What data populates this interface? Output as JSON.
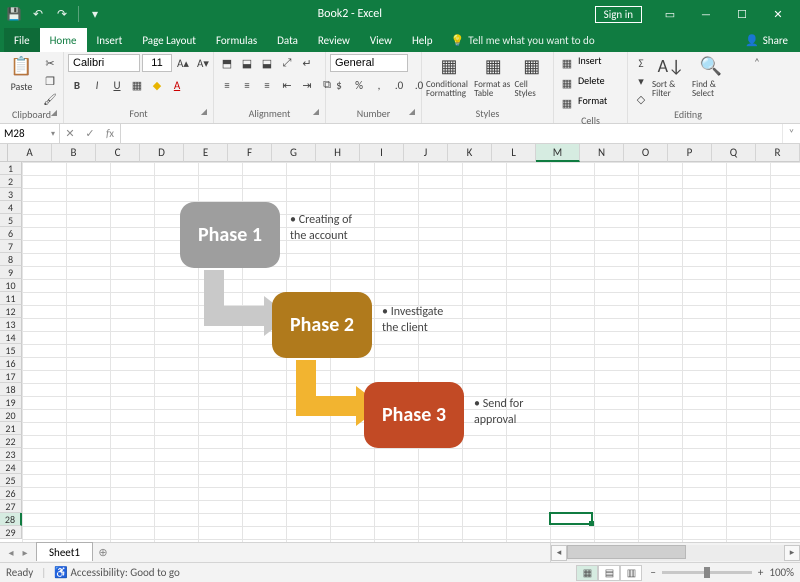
{
  "title": "Book2 - Excel",
  "signin_label": "Sign in",
  "menu": {
    "file": "File",
    "home": "Home",
    "insert": "Insert",
    "page_layout": "Page Layout",
    "formulas": "Formulas",
    "data": "Data",
    "review": "Review",
    "view": "View",
    "help": "Help",
    "tellme": "Tell me what you want to do",
    "share": "Share"
  },
  "ribbon": {
    "clipboard": {
      "paste": "Paste",
      "label": "Clipboard"
    },
    "font": {
      "name": "Calibri",
      "size": "11",
      "label": "Font"
    },
    "alignment": {
      "label": "Alignment"
    },
    "number": {
      "format": "General",
      "label": "Number"
    },
    "styles": {
      "cond": "Conditional Formatting",
      "table": "Format as Table",
      "cell": "Cell Styles",
      "label": "Styles"
    },
    "cells": {
      "insert": "Insert",
      "delete": "Delete",
      "format": "Format",
      "label": "Cells"
    },
    "editing": {
      "sort": "Sort & Filter",
      "find": "Find & Select",
      "label": "Editing"
    }
  },
  "namebox": "M28",
  "columns": [
    "A",
    "B",
    "C",
    "D",
    "E",
    "F",
    "G",
    "H",
    "I",
    "J",
    "K",
    "L",
    "M",
    "N",
    "O",
    "P",
    "Q",
    "R"
  ],
  "rows_count": 29,
  "selected_cell": {
    "col": "M",
    "row": 28
  },
  "smartart": {
    "phase1": {
      "title": "Phase 1",
      "desc": "Creating of the account",
      "fill": "#9e9e9e"
    },
    "phase2": {
      "title": "Phase 2",
      "desc": "Investigate the client",
      "fill": "#b07a1c"
    },
    "phase3": {
      "title": "Phase 3",
      "desc": "Send for approval",
      "fill": "#c24a25"
    },
    "arrow1": "#c9c9c9",
    "arrow2": "#f2b430"
  },
  "sheet_tab": "Sheet1",
  "status": {
    "ready": "Ready",
    "accessibility": "Accessibility: Good to go",
    "zoom": "100%"
  }
}
